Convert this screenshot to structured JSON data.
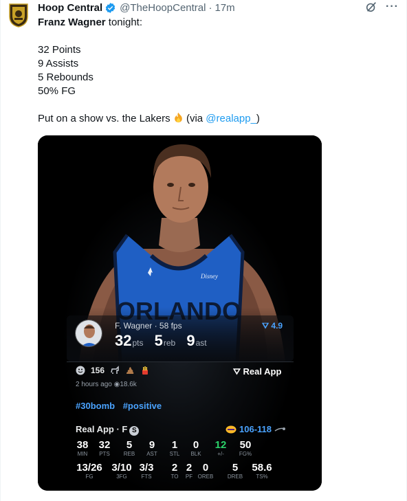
{
  "tweet": {
    "author_name": "Hoop Central",
    "handle": "@TheHoopCentral",
    "separator": "·",
    "time": "17m",
    "more_label": "···",
    "text": {
      "bold_name": "Franz Wagner",
      "line1_rest": " tonight:",
      "stats_lines": [
        "32 Points",
        "9 Assists",
        "5 Rebounds",
        "50% FG"
      ],
      "closing_prefix": "Put on a show vs. the Lakers ",
      "closing_via": " (via ",
      "closing_mention": "@realapp_",
      "closing_suffix": ")"
    }
  },
  "card": {
    "player_label": "F. Wagner · 58 fps",
    "rating": "4.9",
    "big_stats": [
      {
        "value": "32",
        "unit": "pts"
      },
      {
        "value": "5",
        "unit": "reb"
      },
      {
        "value": "9",
        "unit": "ast"
      }
    ],
    "reaction_count": "156",
    "real_app_button": "Real App",
    "posted": "2 hours ago",
    "views": "18.6k",
    "hashtags": [
      "#30bomb",
      "#positive"
    ],
    "source": "Real App · F",
    "source_badge": "S",
    "score": "106-118",
    "box_row1": [
      {
        "v": "38",
        "k": "MIN"
      },
      {
        "v": "32",
        "k": "PTS"
      },
      {
        "v": "5",
        "k": "REB"
      },
      {
        "v": "9",
        "k": "AST"
      },
      {
        "v": "1",
        "k": "STL"
      },
      {
        "v": "0",
        "k": "BLK"
      },
      {
        "v": "12",
        "k": "+/-"
      },
      {
        "v": "50",
        "k": "FG%"
      }
    ],
    "box_row2": [
      {
        "v": "13/26",
        "k": "FG"
      },
      {
        "v": "3/10",
        "k": "3FG"
      },
      {
        "v": "3/3",
        "k": "FTS"
      },
      {
        "v": "2",
        "k": "TO"
      },
      {
        "v": "2",
        "k": "PF"
      },
      {
        "v": "0",
        "k": "OREB"
      },
      {
        "v": "5",
        "k": "DREB"
      },
      {
        "v": "58.6",
        "k": "TS%"
      }
    ]
  },
  "colors": {
    "link": "#1d9bf0",
    "card_accent": "#4aa3ff",
    "jersey": "#1f5fc4",
    "plus_minus": "#2bd46b"
  }
}
